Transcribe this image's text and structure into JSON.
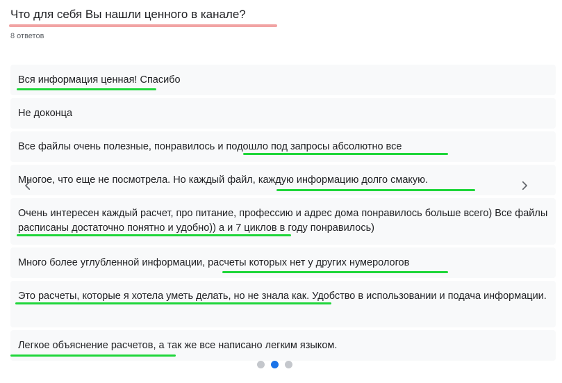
{
  "question": {
    "title": "Что для себя Вы нашли ценного в канале?",
    "count": "8 ответов"
  },
  "responses": [
    "Вся информация ценная! Спасибо",
    "Не доконца",
    "Все файлы очень полезные, понравилось и подошло под запросы абсолютно все",
    "Многое, что еще не посмотрела. Но каждый файл, каждую информацию долго смакую.",
    "Очень интересен каждый расчет, про питание, профессию и адрес дома понравилось больше всего) Все файлы расписаны достаточно понятно и удобно)) а и 7 циклов в году понравилось)",
    "Много более углубленной информации, расчеты которых нет у других нумерологов",
    "Это расчеты, которые я хотела уметь делать, но не знала как. Удобство в использовании и подача информации.",
    "Легкое объяснение расчетов, а так же все написано легким языком."
  ],
  "pagination": {
    "pages": 3,
    "current": 2
  },
  "colors": {
    "title_underline": "#f1a3a3",
    "highlight": "#1fd63a",
    "dot_active": "#1a73e8",
    "dot_inactive": "#c4c7cc",
    "card_bg": "#f8f9fa"
  },
  "icons": {
    "prev": "chevron-left-icon",
    "next": "chevron-right-icon"
  }
}
